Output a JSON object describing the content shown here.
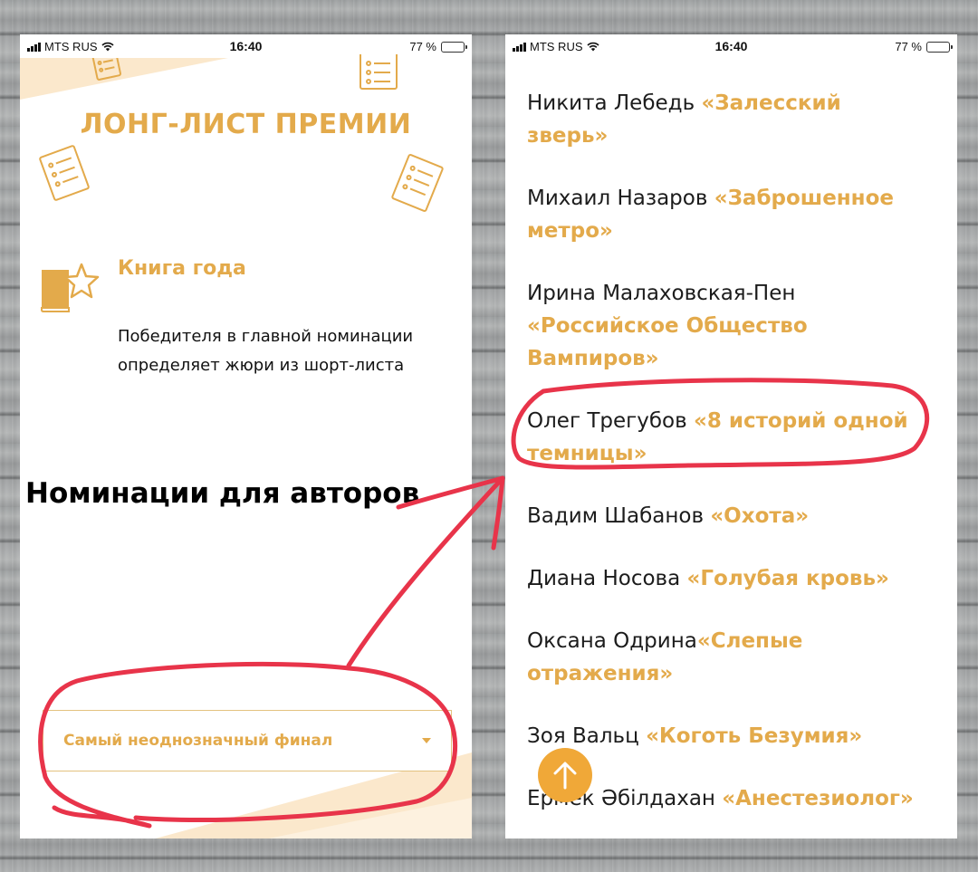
{
  "status_bar": {
    "carrier": "MTS RUS",
    "time": "16:40",
    "battery": "77 %",
    "battery_level": 0.77
  },
  "left_screen": {
    "title": "ЛОНГ-ЛИСТ ПРЕМИИ",
    "award": {
      "title": "Книга года",
      "description": "Победителя в главной номинации определяет жюри из шорт-листа"
    },
    "overlay_heading": "Номинации для авторов",
    "dropdown": {
      "selected": "Самый неоднозначный финал"
    }
  },
  "right_screen": {
    "books": [
      {
        "author": "Никита Лебедь ",
        "title": "«Залесский зверь»"
      },
      {
        "author": "Михаил Назаров ",
        "title": "«Заброшенное метро»"
      },
      {
        "author": "Ирина Малаховская-Пен ",
        "title": "«Российское Общество Вампиров»"
      },
      {
        "author": "Олег Трегубов ",
        "title": "«8 историй одной темницы»"
      },
      {
        "author": "Вадим Шабанов ",
        "title": "«Охота»"
      },
      {
        "author": "Диана Носова ",
        "title": "«Голубая кровь»"
      },
      {
        "author": "Оксана Одрина",
        "title": "«Слепые отражения»"
      },
      {
        "author": "Зоя Вальц ",
        "title": "«Коготь Безумия»"
      },
      {
        "author": "Ермек Әбілдахан ",
        "title": "«Анестезиолог»"
      }
    ]
  },
  "colors": {
    "accent": "#e3aa4b",
    "deco": "#fbe8cc",
    "annotation": "#e8344a",
    "scroll_button": "#f0a838"
  },
  "icons": {
    "award": "book-star-icon",
    "decor": "document-list-icon",
    "scroll_top": "arrow-up-icon"
  }
}
